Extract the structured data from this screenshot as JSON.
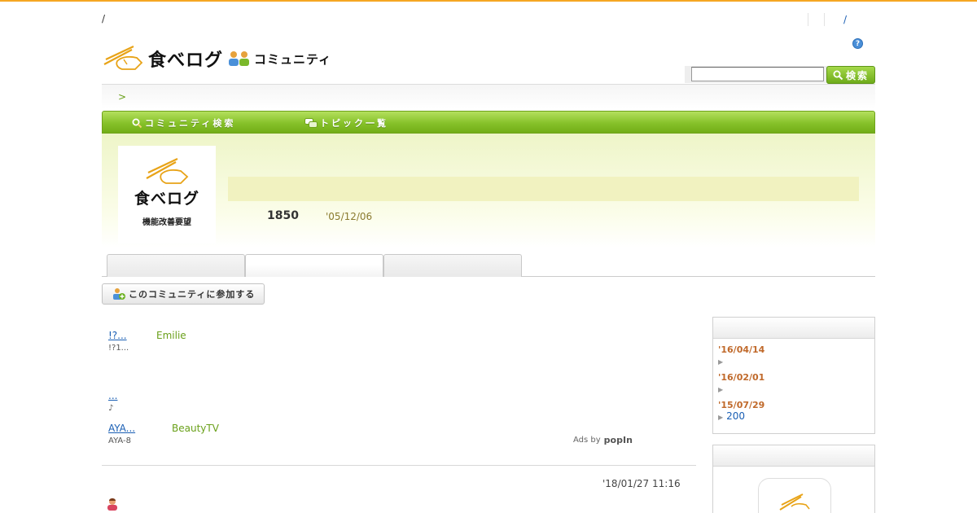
{
  "top_bar": {
    "left_text": "/",
    "right_text": "/"
  },
  "header": {
    "logo_text": "食べログ",
    "logo_community": "コミュニティ",
    "help_icon": "?"
  },
  "search": {
    "placeholder": "",
    "button_label": "検索"
  },
  "breadcrumb": {
    "separator": ">"
  },
  "nav": {
    "items": [
      {
        "label": "コミュニティ検索",
        "icon": "search-icon"
      },
      {
        "label": "トピック一覧",
        "icon": "chat-bubbles-icon"
      }
    ]
  },
  "community": {
    "thumb_logo": "食べログ",
    "thumb_sub": "機能改善要望",
    "member_count": "1850",
    "created_date": "'05/12/06"
  },
  "tabs": [
    {
      "label": "",
      "active": false
    },
    {
      "label": "",
      "active": true
    },
    {
      "label": "",
      "active": false
    }
  ],
  "join_button": {
    "label": "このコミュニティに参加する"
  },
  "sponsored": {
    "items": [
      {
        "title": "!?...",
        "source": "Emilie",
        "desc": "!?1..."
      },
      {
        "title": "...",
        "source": "",
        "desc": ""
      },
      {
        "title": "...",
        "source": "",
        "desc": "♪"
      },
      {
        "title": "AYA...",
        "source": "BeautyTV",
        "desc": "AYA-8"
      }
    ],
    "ads_by": "Ads by",
    "provider": "popIn"
  },
  "post": {
    "date": "'18/01/27 11:16"
  },
  "sidebar": {
    "entries": [
      {
        "date": "'16/04/14",
        "link": ""
      },
      {
        "date": "'16/02/01",
        "link": ""
      },
      {
        "date": "'15/07/29",
        "link": "200"
      }
    ]
  },
  "colors": {
    "accent_green": "#86c12a",
    "top_border": "#f5a623",
    "link_blue": "#1a5fb4",
    "date_orange": "#c0692a"
  }
}
